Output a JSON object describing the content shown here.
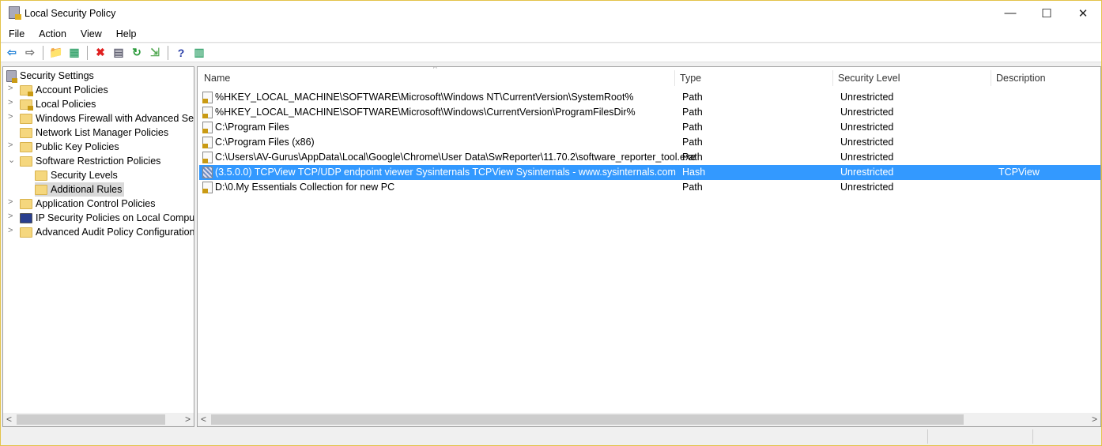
{
  "window": {
    "title": "Local Security Policy",
    "minimize": "—",
    "maximize": "☐",
    "close": "✕"
  },
  "menu": [
    "File",
    "Action",
    "View",
    "Help"
  ],
  "toolbar": [
    {
      "icon": "back-arrow-icon",
      "glyph": "⇦",
      "color": "#1e7fd6"
    },
    {
      "icon": "forward-arrow-icon",
      "glyph": "⇨",
      "color": "#777"
    },
    {
      "sep": true
    },
    {
      "icon": "up-folder-icon",
      "glyph": "📁",
      "color": "#c9a13a"
    },
    {
      "icon": "show-hide-tree-icon",
      "glyph": "▦",
      "color": "#4a7"
    },
    {
      "sep": true
    },
    {
      "icon": "delete-icon",
      "glyph": "✖",
      "color": "#e02020"
    },
    {
      "icon": "properties-icon",
      "glyph": "▤",
      "color": "#667"
    },
    {
      "icon": "refresh-icon",
      "glyph": "↻",
      "color": "#2a9a3a"
    },
    {
      "icon": "export-list-icon",
      "glyph": "⇲",
      "color": "#5a5"
    },
    {
      "sep": true
    },
    {
      "icon": "help-icon",
      "glyph": "?",
      "color": "#2a3fa8"
    },
    {
      "icon": "action-pane-icon",
      "glyph": "▥",
      "color": "#4a7"
    }
  ],
  "tree": [
    {
      "label": "Security Settings",
      "level": 0,
      "chev": "",
      "icon": "security-icon"
    },
    {
      "label": "Account Policies",
      "level": 1,
      "chev": ">",
      "icon": "lock-folder"
    },
    {
      "label": "Local Policies",
      "level": 1,
      "chev": ">",
      "icon": "lock-folder"
    },
    {
      "label": "Windows Firewall with Advanced Security",
      "level": 1,
      "chev": ">",
      "icon": "folder"
    },
    {
      "label": "Network List Manager Policies",
      "level": 1,
      "chev": "",
      "icon": "folder"
    },
    {
      "label": "Public Key Policies",
      "level": 1,
      "chev": ">",
      "icon": "folder"
    },
    {
      "label": "Software Restriction Policies",
      "level": 1,
      "chev": "v",
      "icon": "folder"
    },
    {
      "label": "Security Levels",
      "level": 2,
      "chev": "",
      "icon": "folder"
    },
    {
      "label": "Additional Rules",
      "level": 2,
      "chev": "",
      "icon": "folder",
      "selected": true
    },
    {
      "label": "Application Control Policies",
      "level": 1,
      "chev": ">",
      "icon": "folder"
    },
    {
      "label": "IP Security Policies on Local Computer",
      "level": 1,
      "chev": ">",
      "icon": "ipsec-icon"
    },
    {
      "label": "Advanced Audit Policy Configuration",
      "level": 1,
      "chev": ">",
      "icon": "folder"
    }
  ],
  "columns": [
    "Name",
    "Type",
    "Security Level",
    "Description"
  ],
  "rows": [
    [
      "%HKEY_LOCAL_MACHINE\\SOFTWARE\\Microsoft\\Windows NT\\CurrentVersion\\SystemRoot%",
      "Path",
      "Unrestricted",
      ""
    ],
    [
      "%HKEY_LOCAL_MACHINE\\SOFTWARE\\Microsoft\\Windows\\CurrentVersion\\ProgramFilesDir%",
      "Path",
      "Unrestricted",
      ""
    ],
    [
      "C:\\Program Files",
      "Path",
      "Unrestricted",
      ""
    ],
    [
      "C:\\Program Files (x86)",
      "Path",
      "Unrestricted",
      ""
    ],
    [
      "C:\\Users\\AV-Gurus\\AppData\\Local\\Google\\Chrome\\User Data\\SwReporter\\11.70.2\\software_reporter_tool.exe",
      "Path",
      "Unrestricted",
      ""
    ],
    [
      "(3.5.0.0)  TCPView  TCP/UDP endpoint viewer  Sysinternals TCPView  Sysinternals - www.sysinternals.com",
      "Hash",
      "Unrestricted",
      "TCPView"
    ],
    [
      "D:\\0.My Essentials Collection for new PC",
      "Path",
      "Unrestricted",
      ""
    ]
  ],
  "selected_row": 5,
  "colors": {
    "selection": "#3399ff",
    "border": "#e3c34a"
  }
}
